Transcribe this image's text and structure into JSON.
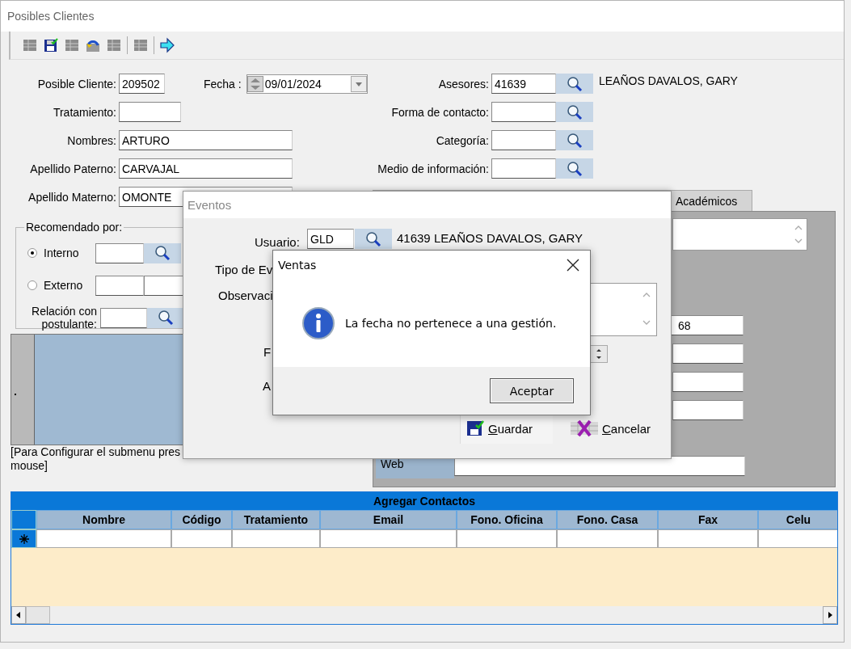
{
  "window": {
    "title": "Posibles Clientes"
  },
  "toolbar": [
    {
      "kind": "grid",
      "disabled": true
    },
    {
      "kind": "save",
      "disabled": false
    },
    {
      "kind": "grid",
      "disabled": true
    },
    {
      "kind": "undo",
      "disabled": false
    },
    {
      "kind": "grid",
      "disabled": true
    },
    {
      "kind": "separator"
    },
    {
      "kind": "grid",
      "disabled": true
    },
    {
      "kind": "separator"
    },
    {
      "kind": "exit",
      "disabled": false
    }
  ],
  "posible_cliente": {
    "label": "Posible Cliente:",
    "value": "209502"
  },
  "fecha": {
    "label": "Fecha :",
    "value": "09/01/2024"
  },
  "left_fields": [
    {
      "label": "Tratamiento:",
      "kind": "short"
    },
    {
      "label": "Nombres:",
      "value": "ARTURO",
      "kind": "long"
    },
    {
      "label": "Apellido Paterno:",
      "value": "CARVAJAL",
      "kind": "long"
    },
    {
      "label": "Apellido Materno:",
      "value": "OMONTE",
      "kind": "long"
    }
  ],
  "right_fields": [
    {
      "label": "Asesores:",
      "value": "41639",
      "name": "LEAÑOS DAVALOS, GARY"
    },
    {
      "label": "Forma de contacto:"
    },
    {
      "label": "Categoría:"
    },
    {
      "label": "Medio de información:"
    }
  ],
  "recomendado": {
    "title": "Recomendado por:",
    "options": [
      {
        "label": "Interno",
        "selected": true
      },
      {
        "label": "Externo",
        "selected": false
      }
    ],
    "relacion_label": "Relación con postulante:"
  },
  "note": [
    "[Para Configurar el submenu pres",
    "mouse]"
  ],
  "visible_tab_label": "Académicos",
  "panel": {
    "values": [
      "68"
    ],
    "web_label": "Web"
  },
  "eventos": {
    "title": "Eventos",
    "usuario_label": "Usuario:",
    "usuario": "GLD",
    "usuario_name": "41639 LEAÑOS DAVALOS, GARY",
    "labels": [
      "Tipo de Ev",
      "Observaci",
      "F",
      "A"
    ],
    "buttons": [
      {
        "label": "Guardar",
        "kind": "save"
      },
      {
        "label": "Cancelar",
        "kind": "cancel"
      }
    ]
  },
  "ventas": {
    "title": "Ventas",
    "message": "La fecha no pertenece a una gestión.",
    "button": "Aceptar"
  },
  "grid": {
    "title": "Agregar Contactos",
    "columns": [
      "Nombre",
      "Código",
      "Tratamiento",
      "Email",
      "Fono. Oficina",
      "Fono. Casa",
      "Fax",
      "Celu"
    ]
  }
}
